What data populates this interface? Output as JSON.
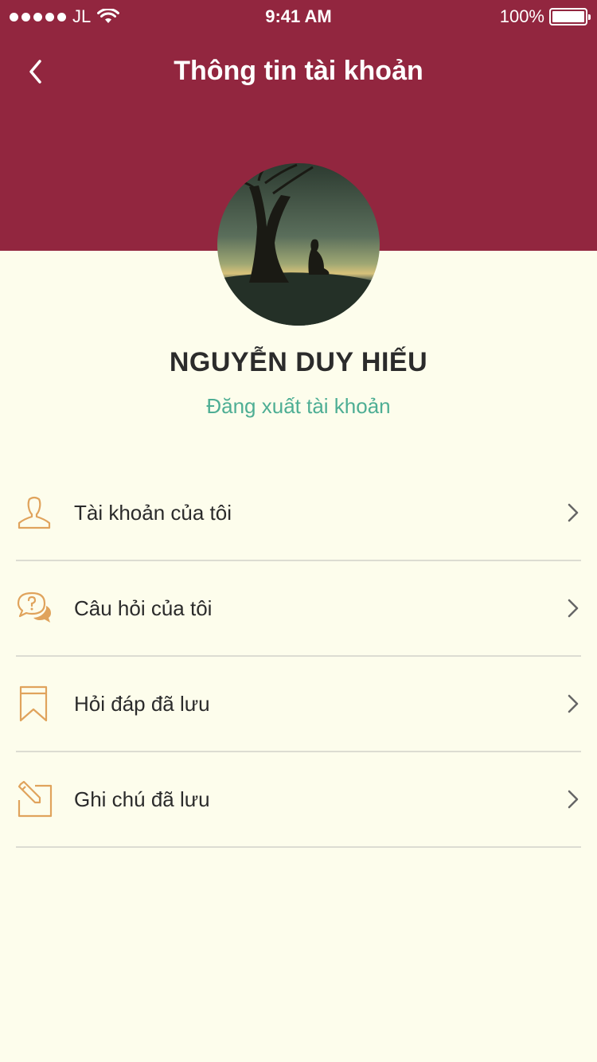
{
  "status_bar": {
    "carrier": "JL",
    "time": "9:41 AM",
    "battery": "100%"
  },
  "nav": {
    "title": "Thông tin tài khoản",
    "back_icon": "chevron-left-icon"
  },
  "profile": {
    "name": "NGUYỄN DUY HIẾU",
    "logout_label": "Đăng xuất tài khoản"
  },
  "menu": {
    "items": [
      {
        "label": "Tài khoản của tôi",
        "icon": "user-icon"
      },
      {
        "label": "Câu hỏi của tôi",
        "icon": "question-bubbles-icon"
      },
      {
        "label": "Hỏi đáp đã lưu",
        "icon": "bookmark-icon"
      },
      {
        "label": "Ghi chú đã lưu",
        "icon": "note-edit-icon"
      }
    ]
  },
  "colors": {
    "header": "#92263F",
    "background": "#FDFDEC",
    "accent": "#4EAE94",
    "icon": "#E0A35C"
  }
}
